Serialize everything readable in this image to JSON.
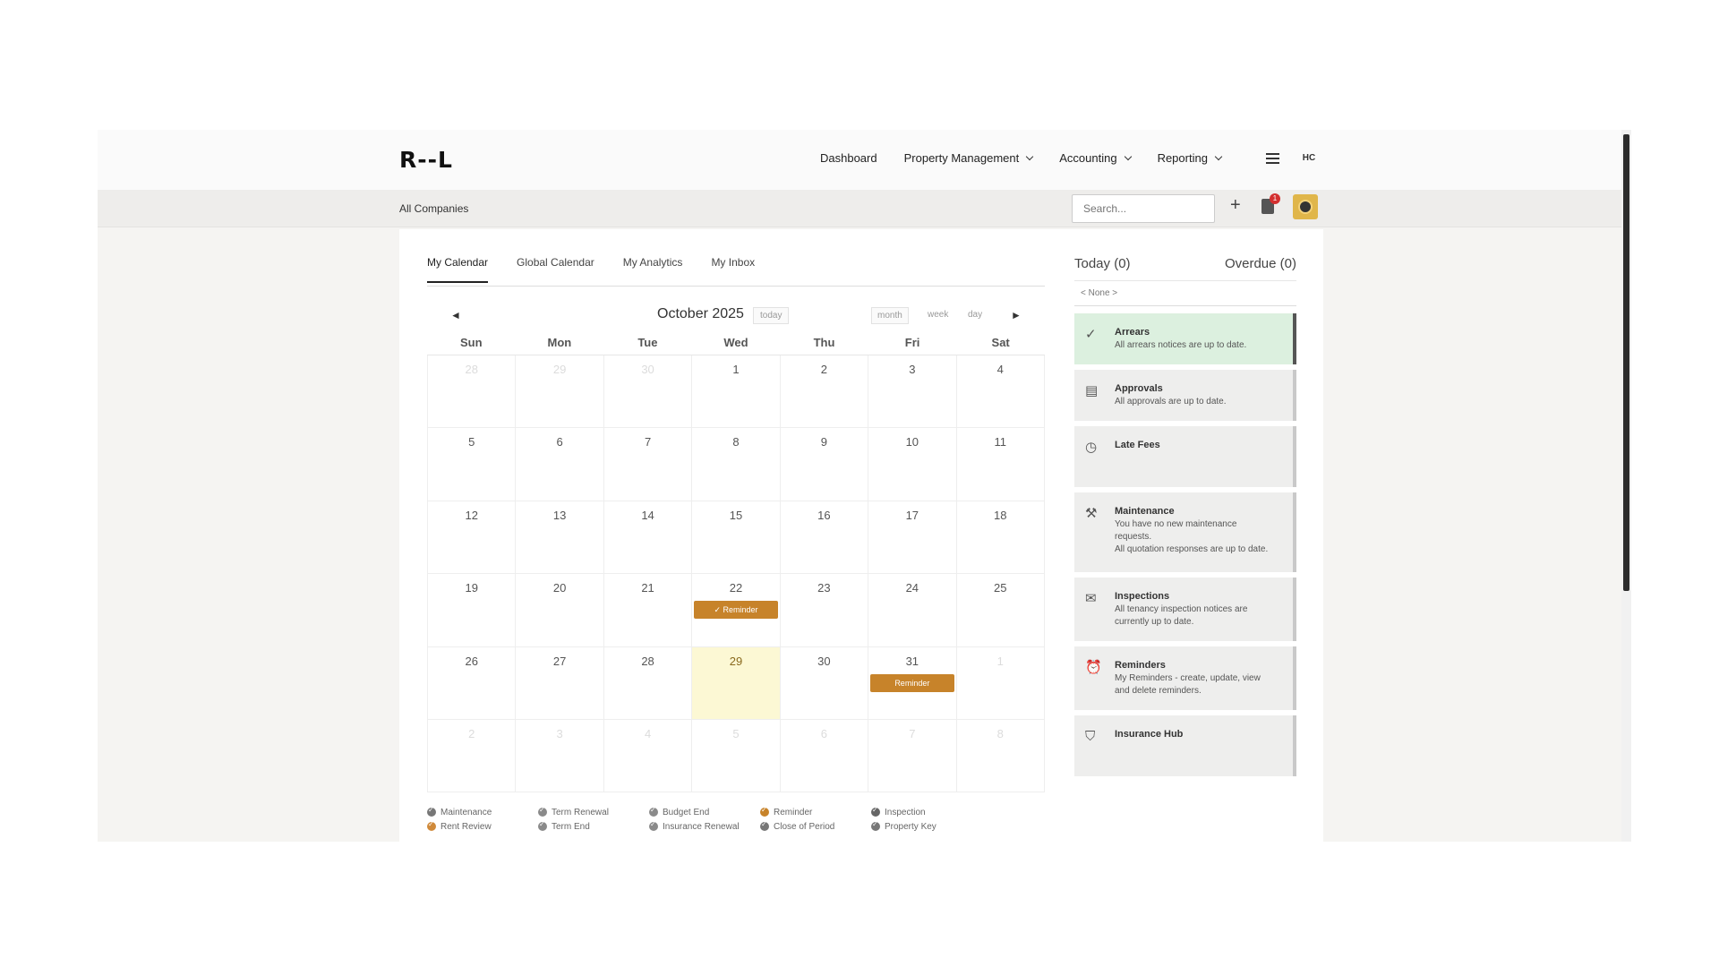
{
  "app": {
    "logo": "R--L",
    "nav": [
      {
        "label": "Dashboard",
        "dropdown": false
      },
      {
        "label": "Property Management",
        "dropdown": true
      },
      {
        "label": "Accounting",
        "dropdown": true
      },
      {
        "label": "Reporting",
        "dropdown": true
      }
    ],
    "user_initials": "HC"
  },
  "subbar": {
    "company": "All Companies",
    "search_placeholder": "Search...",
    "notification_count": "1"
  },
  "tabs": [
    "My Calendar",
    "Global Calendar",
    "My Analytics",
    "My Inbox"
  ],
  "calendar": {
    "title": "October 2025",
    "today_label": "today",
    "views": [
      "month",
      "week",
      "day"
    ],
    "prev_label": "◄",
    "next_label": "►",
    "weekdays": [
      "Sun",
      "Mon",
      "Tue",
      "Wed",
      "Thu",
      "Fri",
      "Sat"
    ],
    "weeks": [
      [
        "28",
        "29",
        "30",
        "1",
        "2",
        "3",
        "4"
      ],
      [
        "5",
        "6",
        "7",
        "8",
        "9",
        "10",
        "11"
      ],
      [
        "12",
        "13",
        "14",
        "15",
        "16",
        "17",
        "18"
      ],
      [
        "19",
        "20",
        "21",
        "22",
        "23",
        "24",
        "25"
      ],
      [
        "26",
        "27",
        "28",
        "29",
        "30",
        "31",
        "1"
      ],
      [
        "2",
        "3",
        "4",
        "5",
        "6",
        "7",
        "8"
      ]
    ],
    "events": [
      {
        "week": 3,
        "day": 3,
        "label": "✓ Reminder"
      },
      {
        "week": 4,
        "day": 5,
        "label": "Reminder"
      }
    ]
  },
  "legend": [
    {
      "label": "Maintenance",
      "color": "#777777"
    },
    {
      "label": "Term Renewal",
      "color": "#8a8a8a"
    },
    {
      "label": "Budget End",
      "color": "#8a8a8a"
    },
    {
      "label": "Reminder",
      "color": "#c7832a"
    },
    {
      "label": "Inspection",
      "color": "#666666"
    },
    {
      "label": "Rent Review",
      "color": "#d08a3a"
    },
    {
      "label": "Term End",
      "color": "#8a8a8a"
    },
    {
      "label": "Insurance Renewal",
      "color": "#8a8a8a"
    },
    {
      "label": "Close of Period",
      "color": "#777777"
    },
    {
      "label": "Property Key",
      "color": "#777777"
    }
  ],
  "summary": {
    "today": "Today (0)",
    "overdue": "Overdue (0)",
    "none": "< None >",
    "cards": [
      {
        "title": "Arrears",
        "body": "All arrears notices are up to date.",
        "icon": "check-circle-icon",
        "glyph": "✓",
        "ok": true
      },
      {
        "title": "Approvals",
        "body": "All approvals are up to date.",
        "icon": "document-icon",
        "glyph": "▤",
        "ok": false
      },
      {
        "title": "Late Fees",
        "body": "",
        "icon": "clock-icon",
        "glyph": "◷",
        "ok": false
      },
      {
        "title": "Maintenance",
        "body": "You have no new maintenance\nrequests.\nAll quotation responses are up to date.",
        "icon": "tools-icon",
        "glyph": "⚒",
        "ok": false
      },
      {
        "title": "Inspections",
        "body": "All tenancy inspection notices are\ncurrently up to date.",
        "icon": "envelope-icon",
        "glyph": "✉",
        "ok": false
      },
      {
        "title": "Reminders",
        "body": "My Reminders - create, update, view\nand delete reminders.",
        "icon": "alarm-icon",
        "glyph": "⏰",
        "ok": false
      },
      {
        "title": "Insurance Hub",
        "body": "",
        "icon": "shield-icon",
        "glyph": "⛉",
        "ok": false
      }
    ]
  }
}
